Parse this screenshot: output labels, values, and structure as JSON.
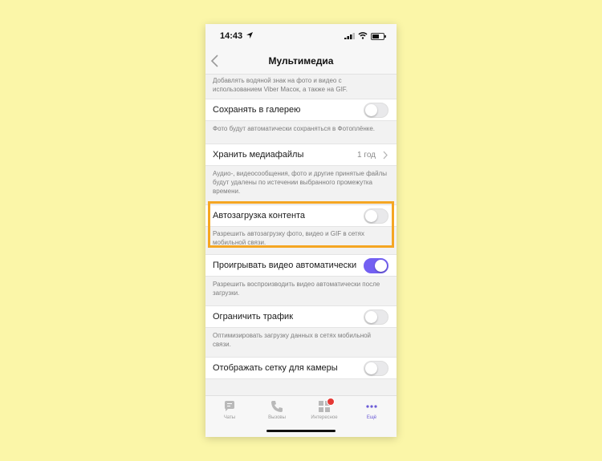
{
  "status": {
    "time": "14:43"
  },
  "nav": {
    "title": "Мультимедиа"
  },
  "notes": {
    "watermark": "Добавлять водяной знак на фото и видео с использованием Viber Масок, а также на GIF.",
    "gallery": "Фото будут автоматически сохраняться в Фотоплёнке.",
    "media": "Аудио-, видеосообщения, фото и другие принятые файлы будут удалены по истечении выбранного промежутка времени.",
    "autoload": "Разрешить автозагрузку фото, видео и GIF в сетях мобильной связи.",
    "autoplay": "Разрешить воспроизводить видео автоматически после загрузки.",
    "traffic": "Оптимизировать загрузку данных в сетях мобильной связи."
  },
  "settings": {
    "gallery": {
      "label": "Сохранять в галерею",
      "on": false
    },
    "media": {
      "label": "Хранить медиафайлы",
      "value": "1 год"
    },
    "autoload": {
      "label": "Автозагрузка контента",
      "on": false
    },
    "autoplay": {
      "label": "Проигрывать видео автоматически",
      "on": true
    },
    "traffic": {
      "label": "Ограничить трафик",
      "on": false
    },
    "grid": {
      "label": "Отображать сетку для камеры",
      "on": false
    }
  },
  "tabs": [
    {
      "label": "Чаты",
      "icon": "chat-icon"
    },
    {
      "label": "Вызовы",
      "icon": "phone-icon"
    },
    {
      "label": "Интересное",
      "icon": "explore-icon"
    },
    {
      "label": "Ещё",
      "icon": "more-icon"
    }
  ],
  "colors": {
    "accent": "#7360f2",
    "highlight": "#f5a623",
    "background": "#fbf6a8"
  }
}
